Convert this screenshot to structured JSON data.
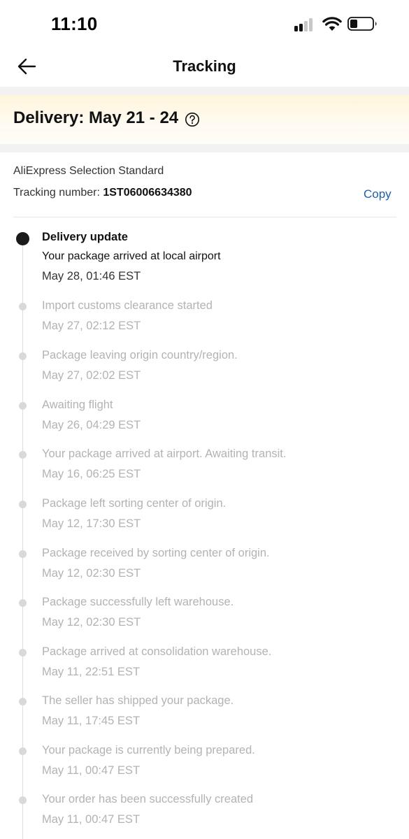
{
  "status_bar": {
    "time": "11:10"
  },
  "header": {
    "title": "Tracking"
  },
  "delivery": {
    "label": "Delivery: May 21 - 24"
  },
  "carrier": {
    "name": "AliExpress Selection Standard",
    "tracking_label": "Tracking number: ",
    "tracking_number": "1ST06006634380",
    "copy_label": "Copy"
  },
  "timeline": {
    "current": {
      "title": "Delivery update",
      "detail": "Your package arrived at local airport",
      "time": "May 28, 01:46 EST"
    },
    "events": [
      {
        "title": "Import customs clearance started",
        "time": "May 27, 02:12 EST"
      },
      {
        "title": "Package leaving origin country/region.",
        "time": "May 27, 02:02 EST"
      },
      {
        "title": "Awaiting flight",
        "time": "May 26, 04:29 EST"
      },
      {
        "title": "Your package arrived at airport. Awaiting transit.",
        "time": "May 16, 06:25 EST"
      },
      {
        "title": "Package left sorting center of origin.",
        "time": "May 12, 17:30 EST"
      },
      {
        "title": "Package received by sorting center of origin.",
        "time": "May 12, 02:30 EST"
      },
      {
        "title": "Package successfully left warehouse.",
        "time": "May 12, 02:30 EST"
      },
      {
        "title": "Package arrived at consolidation warehouse.",
        "time": "May 11, 22:51 EST"
      },
      {
        "title": "The seller has shipped your package.",
        "time": "May 11, 17:45 EST"
      },
      {
        "title": "Your package is currently being prepared.",
        "time": "May 11, 00:47 EST"
      },
      {
        "title": "Your order has been successfully created",
        "time": "May 11, 00:47 EST"
      }
    ]
  },
  "icons": {
    "back": "arrow-left-icon",
    "help": "question-circle-icon",
    "signal": "cellular-signal-icon",
    "wifi": "wifi-icon",
    "battery": "battery-icon"
  },
  "colors": {
    "link": "#1f5fa8",
    "active_dot": "#1a1a1a",
    "inactive_text": "#b3b3b3",
    "banner_bg": "#fff5dc"
  }
}
